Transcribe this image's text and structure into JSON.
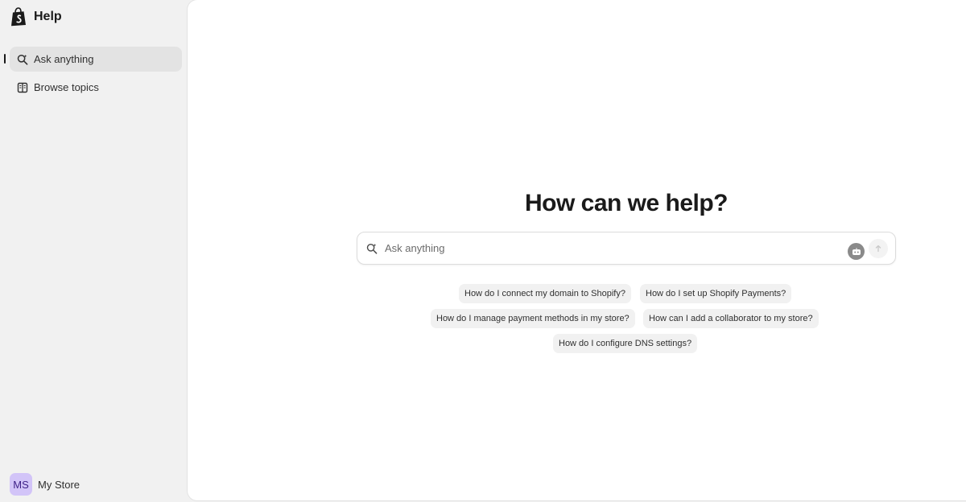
{
  "sidebar": {
    "brand_title": "Help",
    "nav": [
      {
        "label": "Ask anything",
        "icon": "search-sparkle-icon",
        "active": true
      },
      {
        "label": "Browse topics",
        "icon": "book-icon",
        "active": false
      }
    ],
    "store": {
      "initials": "MS",
      "name": "My Store"
    }
  },
  "main": {
    "headline": "How can we help?",
    "search": {
      "placeholder": "Ask anything",
      "value": ""
    },
    "suggestions": [
      "How do I connect my domain to Shopify?",
      "How do I set up Shopify Payments?",
      "How do I manage payment methods in my store?",
      "How can I add a collaborator to my store?",
      "How do I configure DNS settings?"
    ]
  },
  "colors": {
    "page_background": "#f1f1f1",
    "panel_background": "#ffffff",
    "active_nav_background": "#e3e3e3",
    "avatar_background": "#d2c4f8",
    "avatar_text": "#3c1f86",
    "chip_background": "#f1f1f1",
    "brand_logo": "#1a1a1a"
  }
}
